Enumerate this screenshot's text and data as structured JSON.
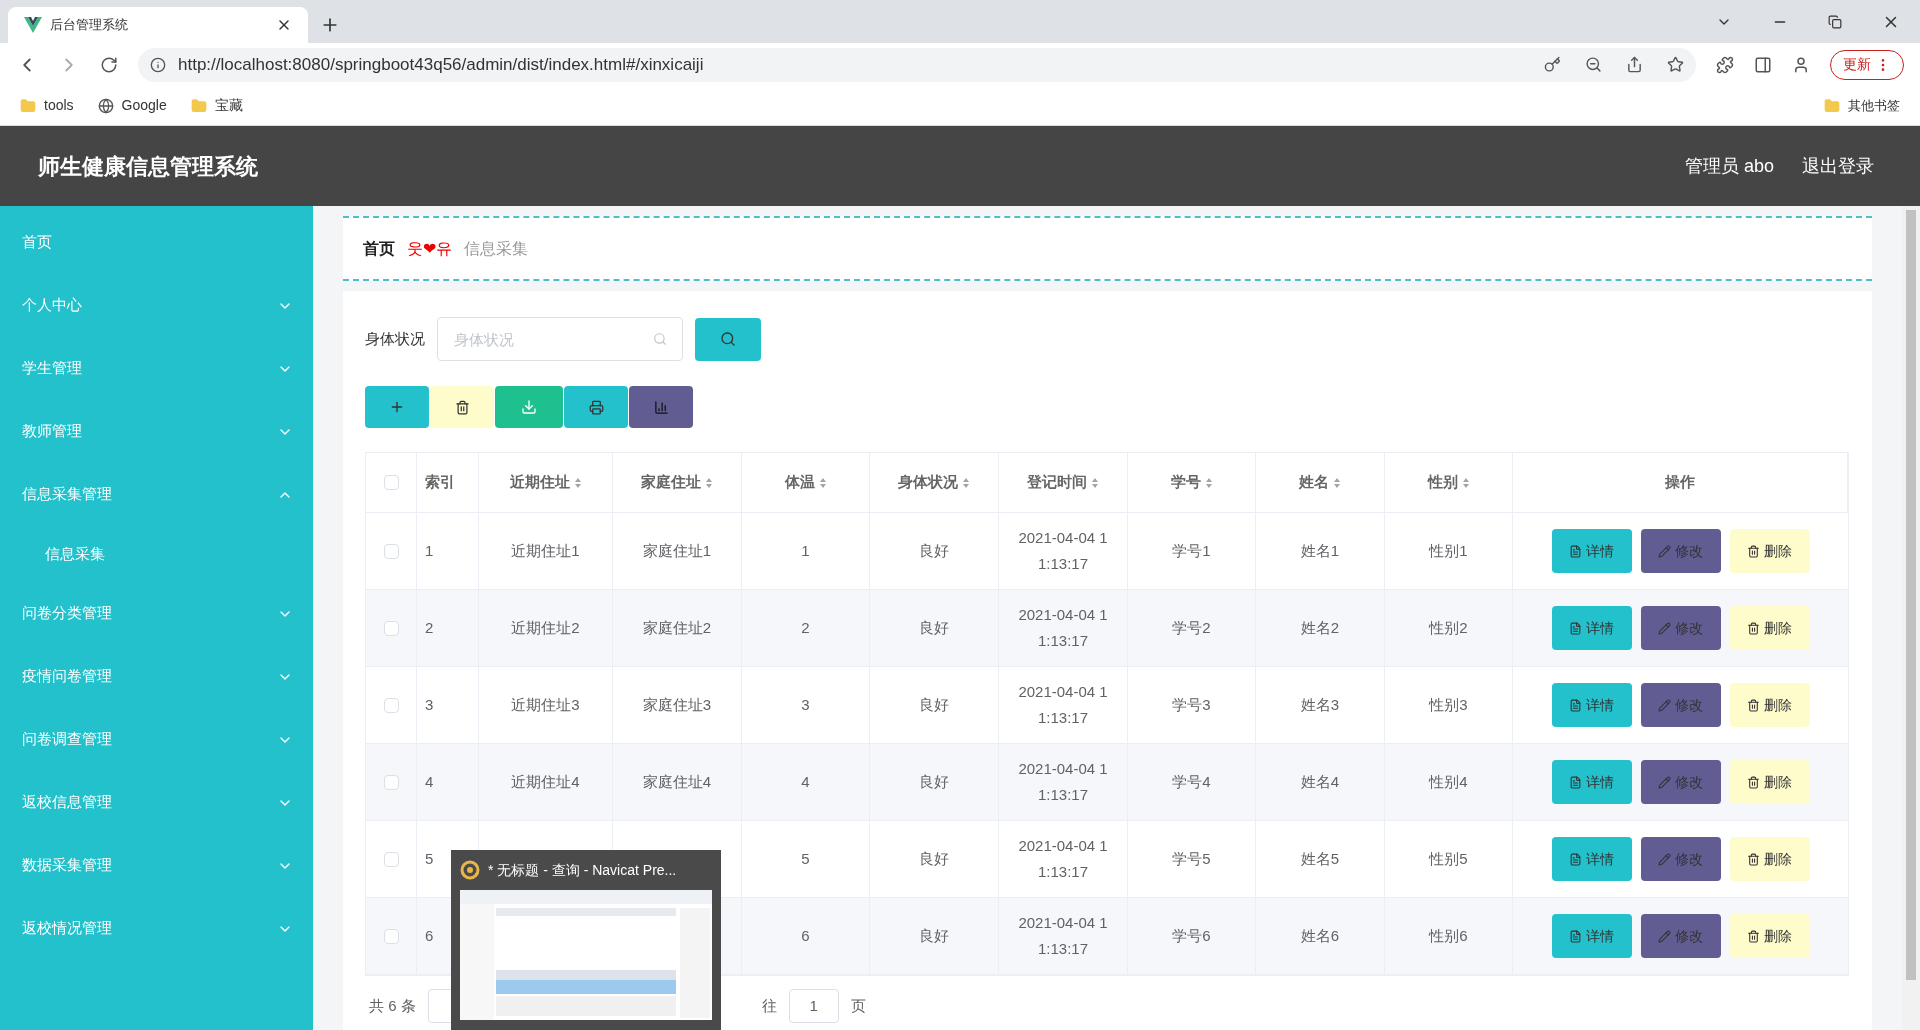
{
  "browser": {
    "tab_title": "后台管理系统",
    "url": "http://localhost:8080/springboot43q56/admin/dist/index.html#/xinxicaiji",
    "update_button": "更新",
    "bookmarks": [
      {
        "label": "tools",
        "kind": "folder"
      },
      {
        "label": "Google",
        "kind": "site"
      },
      {
        "label": "宝藏",
        "kind": "folder"
      }
    ],
    "other_bookmarks": "其他书签"
  },
  "header": {
    "title": "师生健康信息管理系统",
    "user": "管理员 abo",
    "logout": "退出登录"
  },
  "sidebar": {
    "items": [
      {
        "label": "首页",
        "has_children": false
      },
      {
        "label": "个人中心",
        "has_children": true,
        "expanded": false
      },
      {
        "label": "学生管理",
        "has_children": true,
        "expanded": false
      },
      {
        "label": "教师管理",
        "has_children": true,
        "expanded": false
      },
      {
        "label": "信息采集管理",
        "has_children": true,
        "expanded": true,
        "children": [
          {
            "label": "信息采集"
          }
        ]
      },
      {
        "label": "问卷分类管理",
        "has_children": true,
        "expanded": false
      },
      {
        "label": "疫情问卷管理",
        "has_children": true,
        "expanded": false
      },
      {
        "label": "问卷调查管理",
        "has_children": true,
        "expanded": false
      },
      {
        "label": "返校信息管理",
        "has_children": true,
        "expanded": false
      },
      {
        "label": "数据采集管理",
        "has_children": true,
        "expanded": false
      },
      {
        "label": "返校情况管理",
        "has_children": true,
        "expanded": false
      }
    ]
  },
  "breadcrumb": {
    "home": "首页",
    "separator": "웃❤유",
    "current": "信息采集"
  },
  "search": {
    "label": "身体状况",
    "placeholder": "身体状况"
  },
  "table": {
    "select_all_checked": false,
    "columns": [
      {
        "label": "索引",
        "sortable": false
      },
      {
        "label": "近期住址",
        "sortable": true
      },
      {
        "label": "家庭住址",
        "sortable": true
      },
      {
        "label": "体温",
        "sortable": true
      },
      {
        "label": "身体状况",
        "sortable": true
      },
      {
        "label": "登记时间",
        "sortable": true
      },
      {
        "label": "学号",
        "sortable": true
      },
      {
        "label": "姓名",
        "sortable": true
      },
      {
        "label": "性别",
        "sortable": true
      },
      {
        "label": "操作",
        "sortable": false
      }
    ],
    "rows": [
      {
        "checked": false,
        "cells": [
          "1",
          "近期住址1",
          "家庭住址1",
          "1",
          "良好",
          "2021-04-04 11:13:17",
          "学号1",
          "姓名1",
          "性别1"
        ],
        "actions": [
          "详情",
          "修改",
          "删除"
        ]
      },
      {
        "checked": false,
        "cells": [
          "2",
          "近期住址2",
          "家庭住址2",
          "2",
          "良好",
          "2021-04-04 11:13:17",
          "学号2",
          "姓名2",
          "性别2"
        ],
        "actions": [
          "详情",
          "修改",
          "删除"
        ]
      },
      {
        "checked": false,
        "cells": [
          "3",
          "近期住址3",
          "家庭住址3",
          "3",
          "良好",
          "2021-04-04 11:13:17",
          "学号3",
          "姓名3",
          "性别3"
        ],
        "actions": [
          "详情",
          "修改",
          "删除"
        ]
      },
      {
        "checked": false,
        "cells": [
          "4",
          "近期住址4",
          "家庭住址4",
          "4",
          "良好",
          "2021-04-04 11:13:17",
          "学号4",
          "姓名4",
          "性别4"
        ],
        "actions": [
          "详情",
          "修改",
          "删除"
        ]
      },
      {
        "checked": false,
        "cells": [
          "5",
          null,
          null,
          "5",
          "良好",
          "2021-04-04 11:13:17",
          "学号5",
          "姓名5",
          "性别5"
        ],
        "actions": [
          "详情",
          "修改",
          "删除"
        ]
      },
      {
        "checked": false,
        "cells": [
          "6",
          null,
          null,
          "6",
          "良好",
          "2021-04-04 11:13:17",
          "学号6",
          "姓名6",
          "性别6"
        ],
        "actions": [
          "详情",
          "修改",
          "删除"
        ]
      }
    ]
  },
  "pagination": {
    "total": "共 6 条",
    "goto_prefix": "往",
    "page": "1",
    "goto_suffix": "页"
  },
  "taskbar_preview": {
    "title": "* 无标题 - 查询 - Navicat Pre..."
  }
}
